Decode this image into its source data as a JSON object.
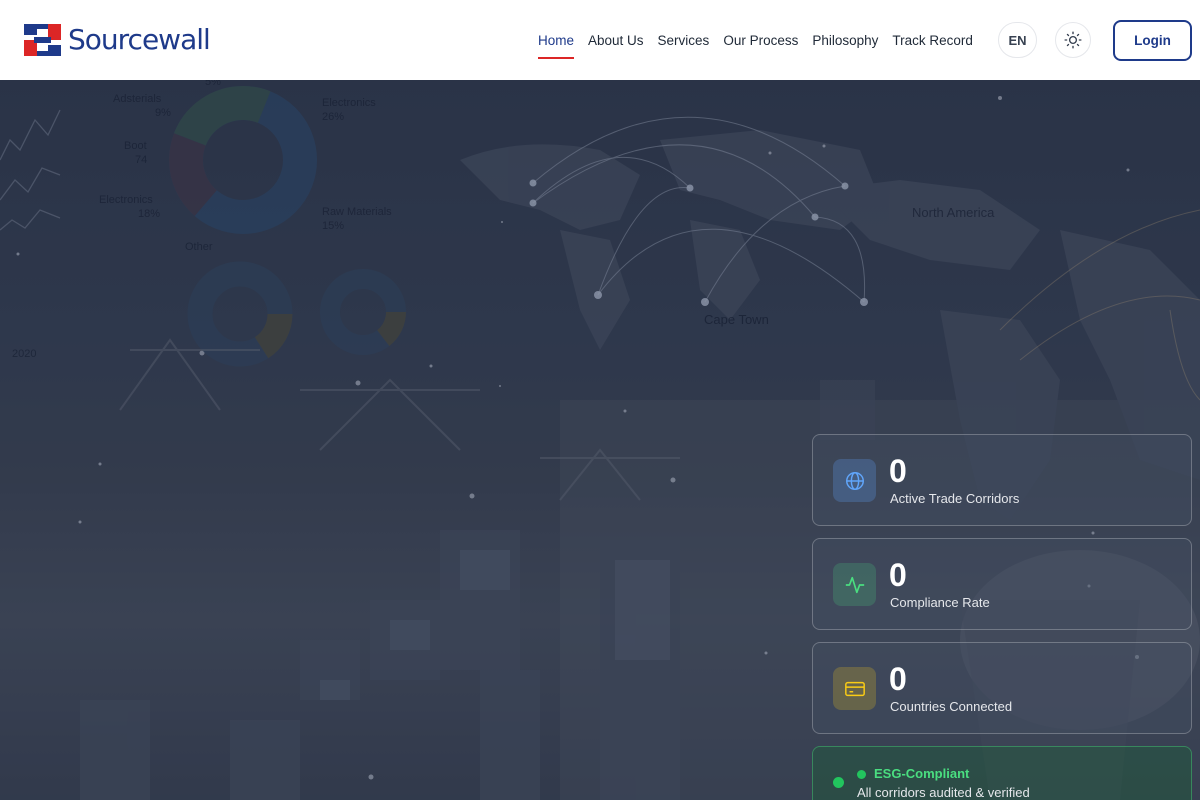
{
  "brand": {
    "name": "Sourcewall",
    "colors": {
      "primary": "#1e3a8a",
      "accent": "#dc2626"
    }
  },
  "nav": {
    "items": [
      {
        "label": "Home",
        "active": true
      },
      {
        "label": "About Us"
      },
      {
        "label": "Services"
      },
      {
        "label": "Our Process"
      },
      {
        "label": "Philosophy"
      },
      {
        "label": "Track Record"
      }
    ],
    "language": "EN",
    "theme_icon": "sun-icon",
    "login_label": "Login"
  },
  "hero_background": {
    "description_icons": [
      "port-cranes",
      "cargo-ship",
      "world-map",
      "donut-charts"
    ],
    "map_labels": [
      "North America",
      "Cape Town"
    ],
    "chart_labels": {
      "year": "2020",
      "slices": [
        {
          "name": "Adsterials",
          "value": "9%"
        },
        {
          "name": "Electronics",
          "value": "26%"
        },
        {
          "name": "Boot",
          "value": "74"
        },
        {
          "name": "Electronics",
          "value": "18%"
        },
        {
          "name": "Raw Materials",
          "value": "15%"
        },
        {
          "name": "Other",
          "value": ""
        }
      ],
      "top_fragment": "5%"
    }
  },
  "stats": [
    {
      "value": "0",
      "label": "Active Trade Corridors",
      "icon": "globe-icon",
      "color": "#60a5fa"
    },
    {
      "value": "0",
      "label": "Compliance Rate",
      "icon": "activity-icon",
      "color": "#4ade80"
    },
    {
      "value": "0",
      "label": "Countries Connected",
      "icon": "credit-card-icon",
      "color": "#facc15"
    }
  ],
  "esg": {
    "title": "ESG-Compliant",
    "subtitle": "All corridors audited & verified",
    "color": "#22c55e"
  }
}
